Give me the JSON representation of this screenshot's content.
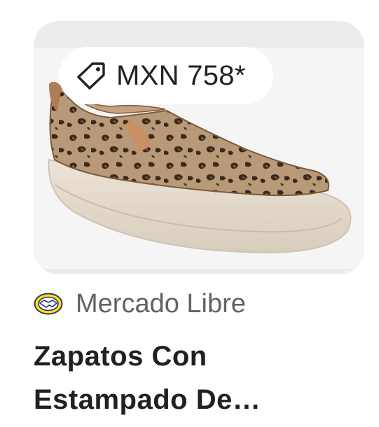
{
  "result_card": {
    "price": "MXN 758*",
    "source": "Mercado Libre",
    "title": "Zapatos Con Estampado De…"
  },
  "icons": {
    "price_tag": "tag-icon",
    "source_logo": "mercado-libre-handshake-logo"
  },
  "colors": {
    "image_frame_bg": "#ececee",
    "title_text": "#202124",
    "source_text": "#5f6368",
    "logo_yellow": "#ffe600",
    "logo_blue": "#2d3277"
  }
}
